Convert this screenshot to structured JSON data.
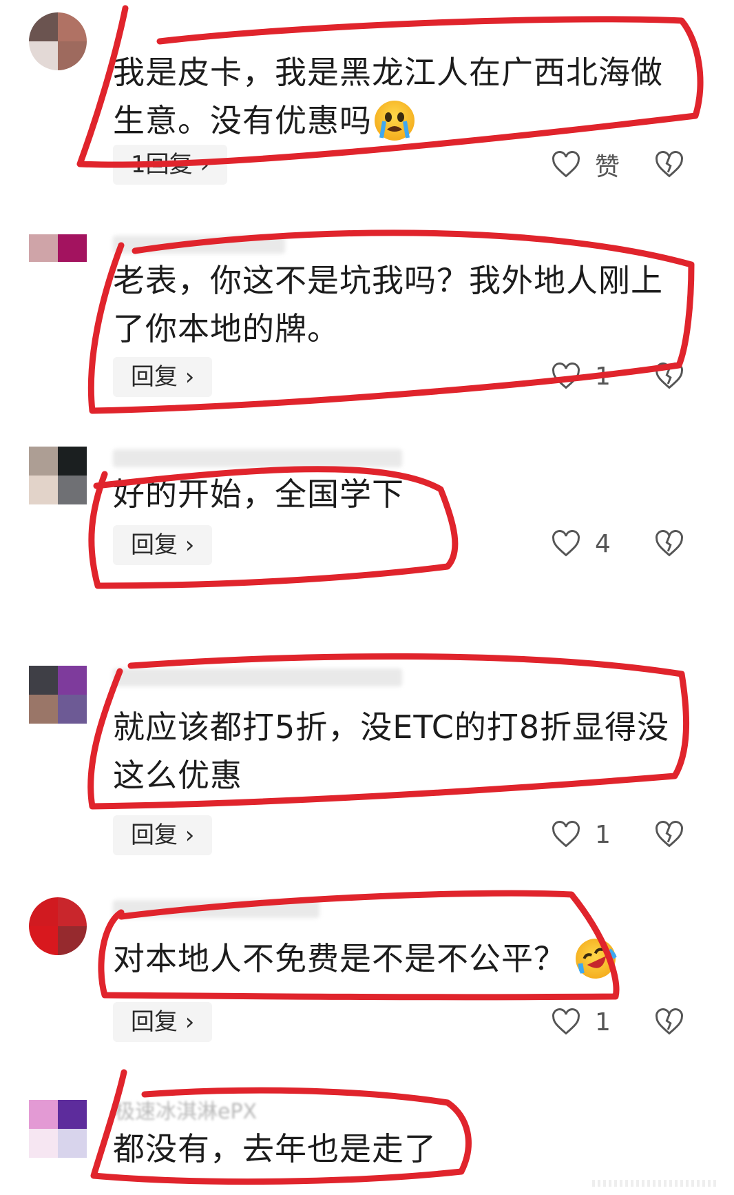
{
  "comments": [
    {
      "text_line1": "我是皮卡，我是黑龙江人在广西北海做",
      "text_line2": "生意。没有优惠吗",
      "emoji": "crying-face",
      "reply_label": "1回复 ›",
      "like_count": "赞"
    },
    {
      "text_line1": "老表，你这不是坑我吗？我外地人刚上",
      "text_line2": "了你本地的牌。",
      "reply_label": "回复 ›",
      "like_count": "1"
    },
    {
      "text_line1": "好的开始，全国学下",
      "reply_label": "回复 ›",
      "like_count": "4"
    },
    {
      "text_line1": "就应该都打5折，没ETC的打8折显得没",
      "text_line2": "这么优惠",
      "reply_label": "回复 ›",
      "like_count": "1"
    },
    {
      "text_line1": "对本地人不免费是不是不公平？",
      "emoji": "laughing-crying-face",
      "reply_label": "回复 ›",
      "like_count": "1"
    },
    {
      "text_line1": "都没有，去年也是走了",
      "username_partial": "极速冰淇淋ePX"
    }
  ],
  "colors": {
    "annotation_red": "#e0242c",
    "reply_bg": "#f4f4f4",
    "icon_gray": "#555555"
  }
}
